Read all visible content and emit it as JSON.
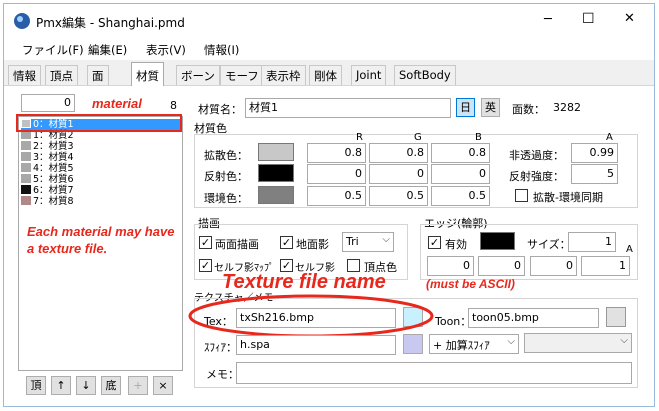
{
  "window": {
    "title": "Pmx編集 - Shanghai.pmd",
    "minimize": "─",
    "maximize": "☐",
    "close": "✕"
  },
  "menu": [
    "ファイル(F)",
    "編集(E)",
    "表示(V)",
    "情報(I)"
  ],
  "tabs": [
    "情報",
    "頂点",
    "面",
    "材質",
    "ボーン",
    "モーフ",
    "表示枠",
    "剛体",
    "Joint",
    "SoftBody"
  ],
  "active_tab": "材質",
  "material_list": {
    "search_value": "0",
    "count": "8",
    "items": [
      {
        "label": "0：材質1",
        "swatch": "#c0c0c0",
        "selected": true
      },
      {
        "label": "1：材質2",
        "swatch": "#a8a8a8",
        "selected": false
      },
      {
        "label": "2：材質3",
        "swatch": "#a8a8a8",
        "selected": false
      },
      {
        "label": "3：材質4",
        "swatch": "#a8a8a8",
        "selected": false
      },
      {
        "label": "4：材質5",
        "swatch": "#a8a8a8",
        "selected": false
      },
      {
        "label": "5：材質6",
        "swatch": "#a8a8a8",
        "selected": false
      },
      {
        "label": "6：材質7",
        "swatch": "#111111",
        "selected": false
      },
      {
        "label": "7：材質8",
        "swatch": "#b08888",
        "selected": false
      }
    ],
    "buttons": [
      "頂",
      "↑",
      "↓",
      "底",
      "+",
      "×"
    ]
  },
  "material": {
    "name_label": "材質名：",
    "name_value": "材質1",
    "jp_button": "日",
    "en_button": "英",
    "faces_label": "面数：",
    "faces_value": "3282",
    "color_section": "材質色",
    "rgba_headers": [
      "R",
      "G",
      "B",
      "A"
    ],
    "diffuse": {
      "label": "拡散色：",
      "r": "0.8",
      "g": "0.8",
      "b": "0.8",
      "swatch": "#c8c8c8"
    },
    "specular": {
      "label": "反射色：",
      "r": "0",
      "g": "0",
      "b": "0",
      "swatch": "#000000"
    },
    "ambient": {
      "label": "環境色：",
      "r": "0.5",
      "g": "0.5",
      "b": "0.5",
      "swatch": "#808080"
    },
    "opacity": {
      "label": "非透過度：",
      "value": "0.99"
    },
    "specular_power": {
      "label": "反射強度：",
      "value": "5"
    },
    "sync_checkbox": "拡散-環境同期"
  },
  "draw": {
    "section": "描画",
    "double_sided": "両面描画",
    "ground_shadow": "地面影",
    "prim_type": "Tri",
    "self_shadow_map": "セルフ影ﾏｯﾌﾟ",
    "self_shadow": "セルフ影",
    "vertex_color": "頂点色"
  },
  "edge": {
    "section": "エッジ(輪郭)",
    "enabled": "有効",
    "swatch": "#000000",
    "size_label": "サイズ：",
    "size_value": "1",
    "a_header": "A",
    "rgba": [
      "0",
      "0",
      "0",
      "1"
    ]
  },
  "texture": {
    "section": "テクスチャ／メモ",
    "tex_label": "Tex：",
    "tex_value": "txSh216.bmp",
    "toon_label": "Toon：",
    "toon_value": "toon05.bmp",
    "sphere_label": "ｽﾌｨｱ：",
    "sphere_value": "h.spa",
    "sphere_mode": "+ 加算ｽﾌｨｱ",
    "memo_label": "メモ：",
    "memo_value": ""
  },
  "annotations": {
    "material": "material",
    "each_material": "Each material may have a texture file.",
    "texture_title": "Texture file name",
    "texture_note": "(must be ASCII)",
    "color": "#e8281c"
  }
}
